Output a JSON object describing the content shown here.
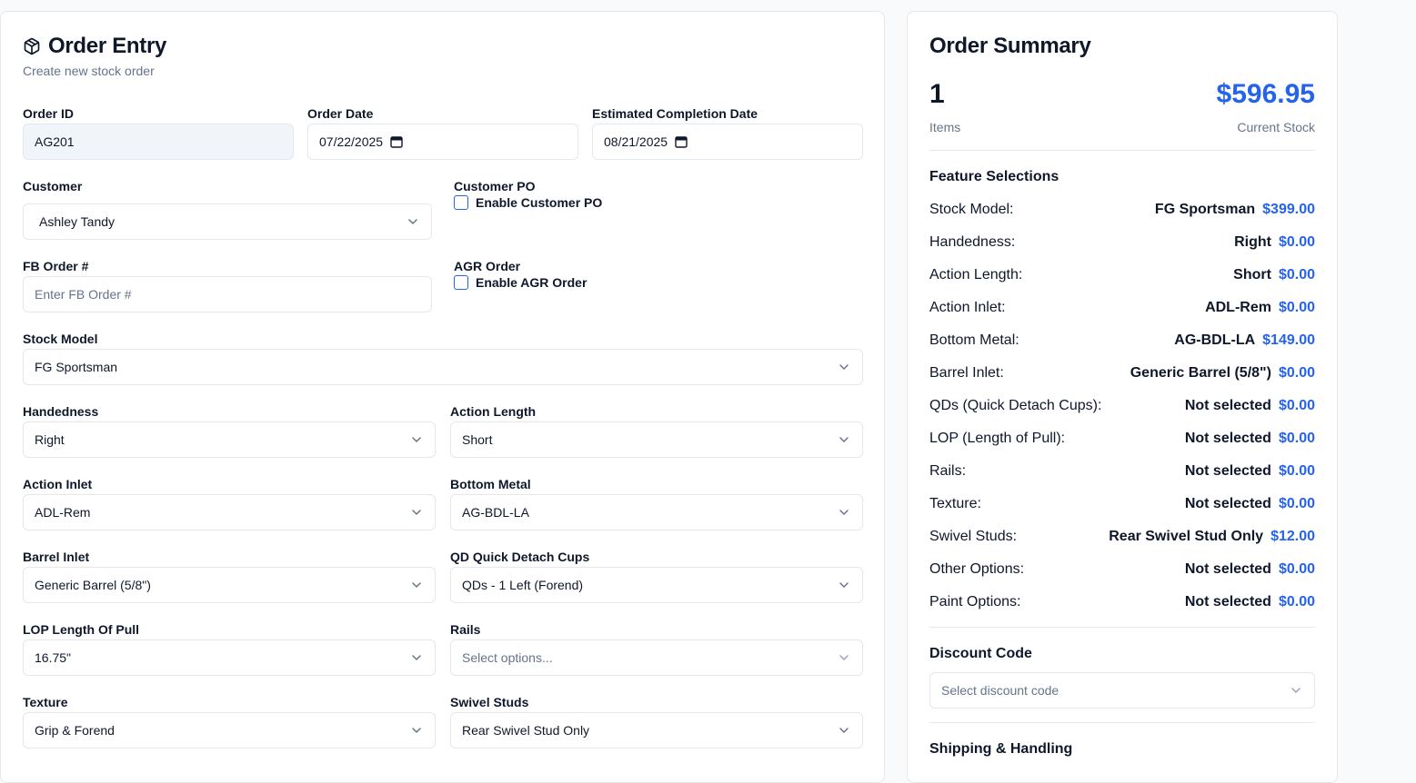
{
  "entry": {
    "title": "Order Entry",
    "subtitle": "Create new stock order",
    "order_id": {
      "label": "Order ID",
      "value": "AG201"
    },
    "order_date": {
      "label": "Order Date",
      "value": "07/22/2025"
    },
    "est_completion": {
      "label": "Estimated Completion Date",
      "value": "08/21/2025"
    },
    "customer": {
      "label": "Customer",
      "value": "Ashley Tandy"
    },
    "customer_po": {
      "label": "Customer PO",
      "checkbox_label": "Enable Customer PO"
    },
    "fb_order": {
      "label": "FB Order #",
      "placeholder": "Enter FB Order #"
    },
    "agr_order": {
      "label": "AGR Order",
      "checkbox_label": "Enable AGR Order"
    },
    "stock_model": {
      "label": "Stock Model",
      "value": "FG Sportsman"
    },
    "handedness": {
      "label": "Handedness",
      "value": "Right"
    },
    "action_length": {
      "label": "Action Length",
      "value": "Short"
    },
    "action_inlet": {
      "label": "Action Inlet",
      "value": "ADL-Rem"
    },
    "bottom_metal": {
      "label": "Bottom Metal",
      "value": "AG-BDL-LA"
    },
    "barrel_inlet": {
      "label": "Barrel Inlet",
      "value": "Generic Barrel (5/8\")"
    },
    "qd_cups": {
      "label": "QD Quick Detach Cups",
      "value": "QDs - 1 Left (Forend)"
    },
    "lop": {
      "label": "LOP Length Of Pull",
      "value": "16.75\""
    },
    "rails": {
      "label": "Rails",
      "placeholder": "Select options..."
    },
    "texture": {
      "label": "Texture",
      "value": "Grip & Forend"
    },
    "swivel_studs": {
      "label": "Swivel Studs",
      "value": "Rear Swivel Stud Only"
    }
  },
  "summary": {
    "title": "Order Summary",
    "items_count": "1",
    "items_label": "Items",
    "total": "$596.95",
    "total_label": "Current Stock",
    "features_heading": "Feature Selections",
    "features": [
      {
        "label": "Stock Model:",
        "value": "FG Sportsman",
        "price": "$399.00"
      },
      {
        "label": "Handedness:",
        "value": "Right",
        "price": "$0.00"
      },
      {
        "label": "Action Length:",
        "value": "Short",
        "price": "$0.00"
      },
      {
        "label": "Action Inlet:",
        "value": "ADL-Rem",
        "price": "$0.00"
      },
      {
        "label": "Bottom Metal:",
        "value": "AG-BDL-LA",
        "price": "$149.00"
      },
      {
        "label": "Barrel Inlet:",
        "value": "Generic Barrel (5/8\")",
        "price": "$0.00"
      },
      {
        "label": "QDs (Quick Detach Cups):",
        "value": "Not selected",
        "price": "$0.00"
      },
      {
        "label": "LOP (Length of Pull):",
        "value": "Not selected",
        "price": "$0.00"
      },
      {
        "label": "Rails:",
        "value": "Not selected",
        "price": "$0.00"
      },
      {
        "label": "Texture:",
        "value": "Not selected",
        "price": "$0.00"
      },
      {
        "label": "Swivel Studs:",
        "value": "Rear Swivel Stud Only",
        "price": "$12.00"
      },
      {
        "label": "Other Options:",
        "value": "Not selected",
        "price": "$0.00"
      },
      {
        "label": "Paint Options:",
        "value": "Not selected",
        "price": "$0.00"
      }
    ],
    "discount_heading": "Discount Code",
    "discount_placeholder": "Select discount code",
    "shipping_heading": "Shipping & Handling"
  },
  "colors": {
    "accent": "#2563eb",
    "muted": "#64748b",
    "border": "#e2e8f0"
  }
}
